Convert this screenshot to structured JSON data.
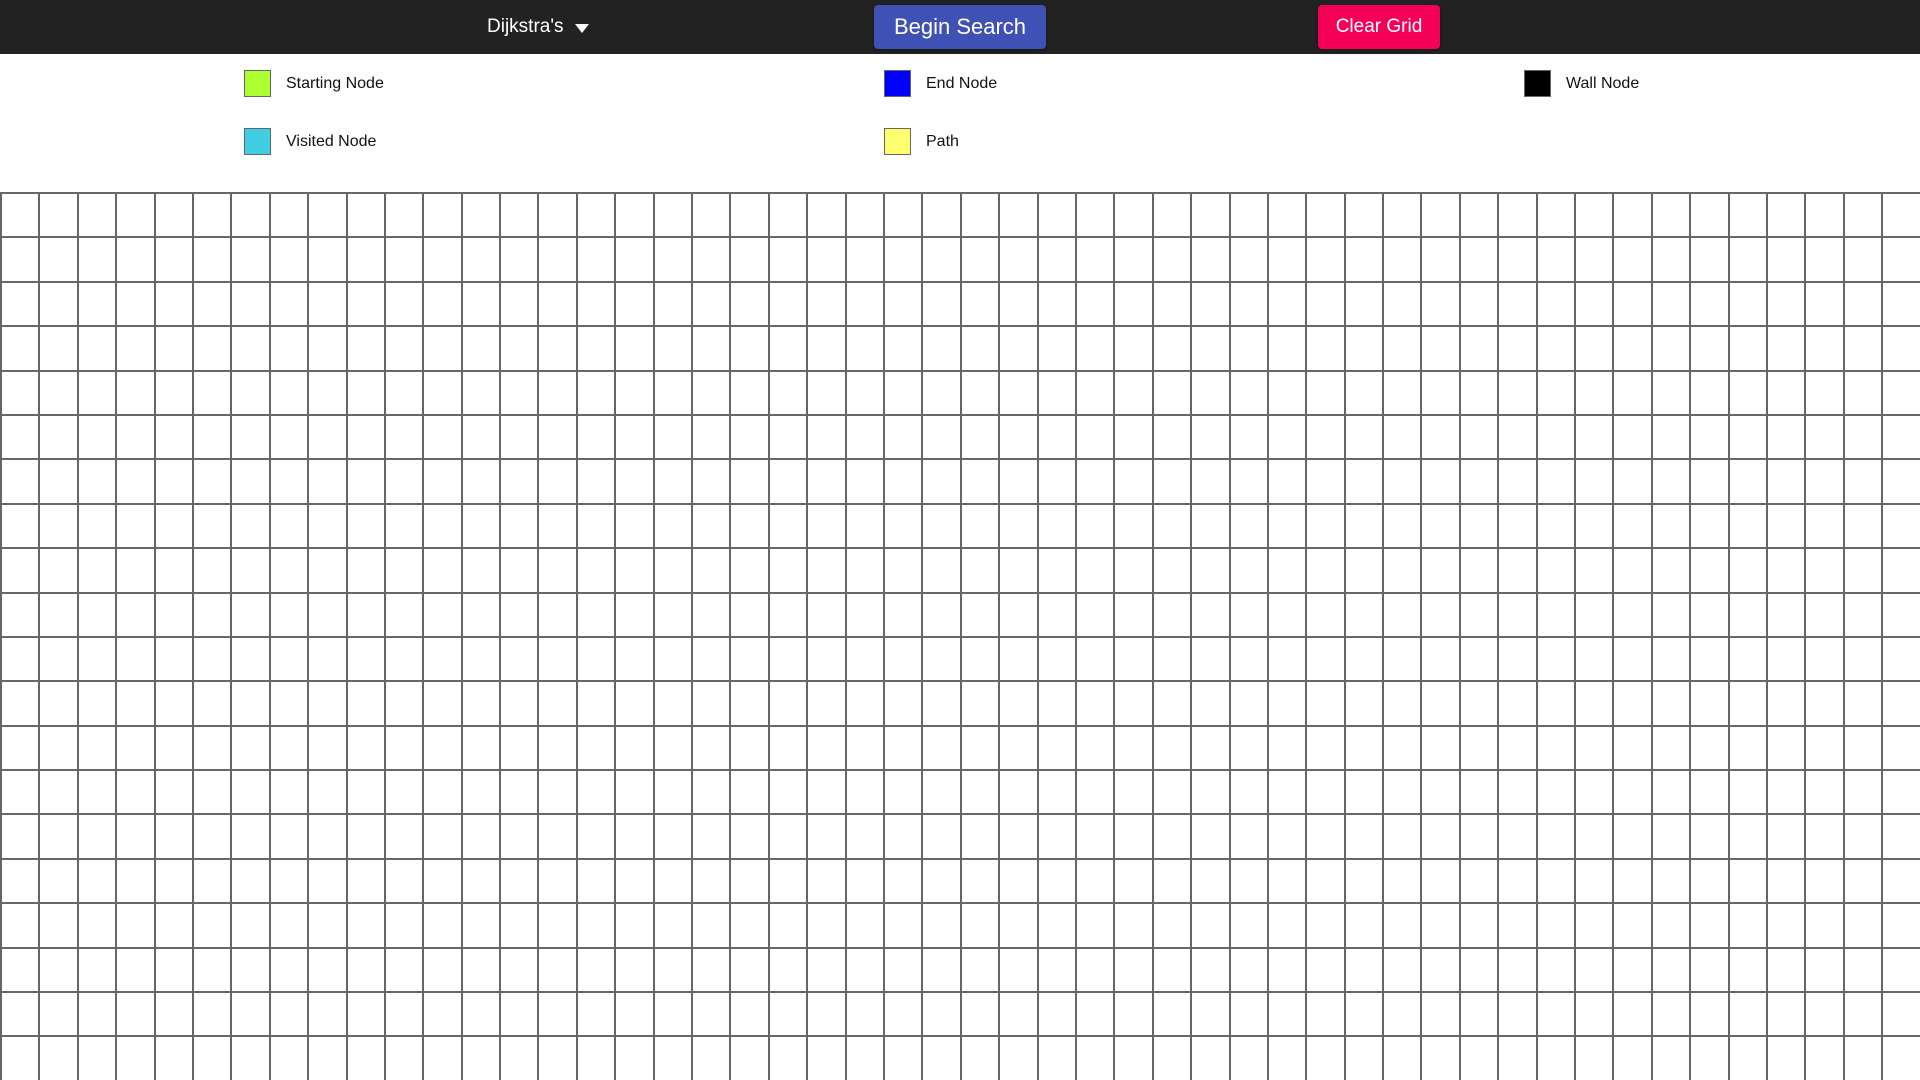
{
  "header": {
    "algorithm_select": {
      "selected": "Dijkstra's",
      "icon": "caret-down-icon"
    },
    "begin_search_label": "Begin Search",
    "clear_grid_label": "Clear Grid",
    "colors": {
      "bar": "#222222",
      "begin_search": "#3f51b5",
      "clear_grid": "#f50057"
    }
  },
  "legend": [
    {
      "label": "Starting Node",
      "color": "#adff2f"
    },
    {
      "label": "End Node",
      "color": "#0000ff"
    },
    {
      "label": "Wall Node",
      "color": "#000000"
    },
    {
      "label": "Visited Node",
      "color": "#40cee3"
    },
    {
      "label": "Path",
      "color": "#ffff6e"
    }
  ],
  "grid": {
    "rows": 20,
    "cols": 50,
    "cell_color": "#ffffff",
    "line_color": "#666666"
  }
}
